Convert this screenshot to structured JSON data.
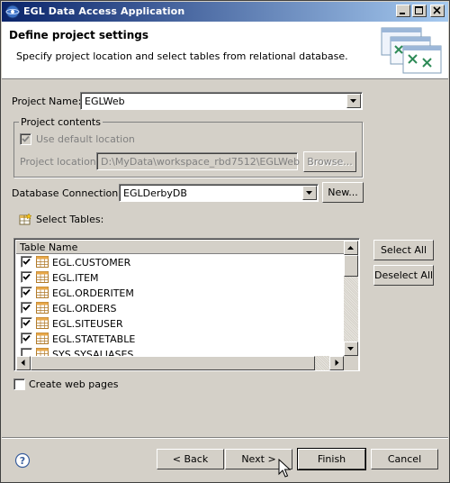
{
  "window": {
    "title": "EGL Data Access Application",
    "controls": [
      "minimize-icon",
      "maximize-icon",
      "close-icon"
    ]
  },
  "banner": {
    "title": "Define project settings",
    "description": "Specify project location and select tables from relational database."
  },
  "project_name": {
    "label": "Project Name:",
    "value": "EGLWeb"
  },
  "project_contents": {
    "title": "Project contents",
    "use_default_label": "Use default location",
    "use_default_checked": true,
    "location_label": "Project location:",
    "location_value": "D:\\MyData\\workspace_rbd7512\\EGLWeb",
    "browse_label": "Browse..."
  },
  "database": {
    "label": "Database Connection:",
    "value": "EGLDerbyDB",
    "new_label": "New..."
  },
  "tables": {
    "label": "Select Tables:",
    "column_header": "Table Name",
    "rows": [
      {
        "name": "EGL.CUSTOMER",
        "checked": true
      },
      {
        "name": "EGL.ITEM",
        "checked": true
      },
      {
        "name": "EGL.ORDERITEM",
        "checked": true
      },
      {
        "name": "EGL.ORDERS",
        "checked": true
      },
      {
        "name": "EGL.SITEUSER",
        "checked": true
      },
      {
        "name": "EGL.STATETABLE",
        "checked": true
      },
      {
        "name": "SYS.SYSALIASES",
        "checked": false
      }
    ],
    "select_all_label": "Select All",
    "deselect_all_label": "Deselect All"
  },
  "create_web_pages": {
    "label": "Create web pages",
    "checked": false
  },
  "footer": {
    "back_label": "< Back",
    "next_label": "Next >",
    "finish_label": "Finish",
    "cancel_label": "Cancel"
  }
}
